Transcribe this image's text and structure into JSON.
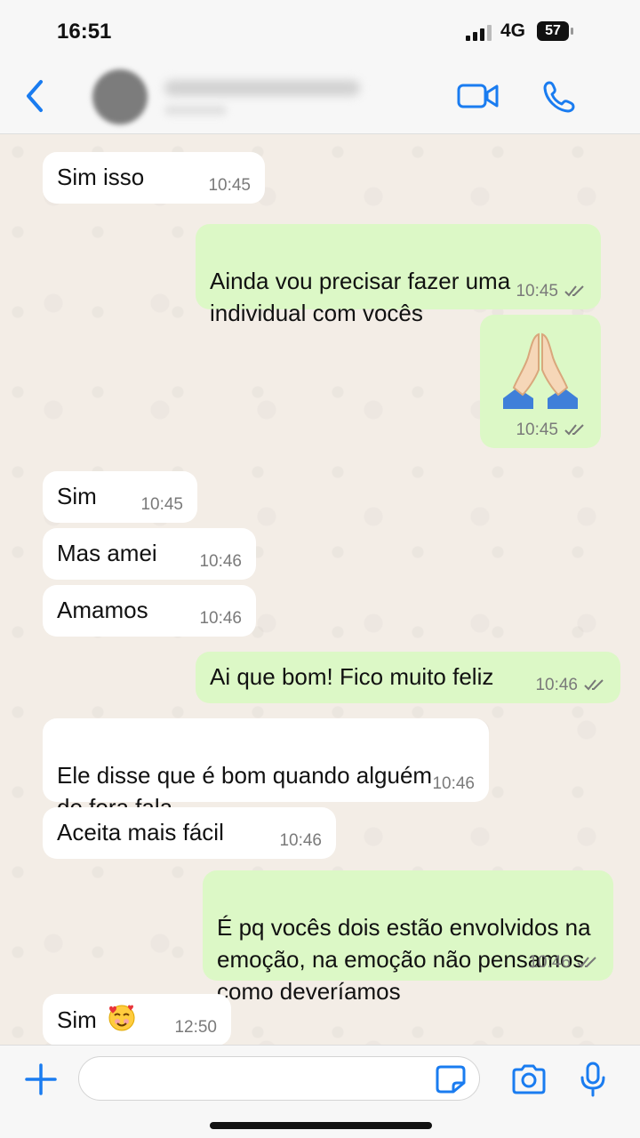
{
  "status_bar": {
    "time": "16:51",
    "network": "4G",
    "battery": "57"
  },
  "header": {
    "icons": [
      "chevron-left-icon",
      "video-call-icon",
      "phone-icon"
    ]
  },
  "messages": [
    {
      "dir": "in",
      "text": "Sim isso",
      "time": "10:45"
    },
    {
      "dir": "out",
      "text": "Ainda vou precisar fazer uma\nindividual com vocês",
      "time": "10:45",
      "read": true
    },
    {
      "dir": "out",
      "emoji": "folded-hands",
      "time": "10:45",
      "read": true
    },
    {
      "dir": "in",
      "text": "Sim",
      "time": "10:45"
    },
    {
      "dir": "in",
      "text": "Mas amei",
      "time": "10:46"
    },
    {
      "dir": "in",
      "text": "Amamos",
      "time": "10:46"
    },
    {
      "dir": "out",
      "text": "Ai que bom! Fico muito feliz",
      "time": "10:46",
      "read": true
    },
    {
      "dir": "in",
      "text": "Ele disse que é bom quando alguém\nde fora fala",
      "time": "10:46"
    },
    {
      "dir": "in",
      "text": "Aceita mais fácil",
      "time": "10:46"
    },
    {
      "dir": "out",
      "text": "É pq vocês dois estão envolvidos na\nemoção,  na emoção não pensamos\ncomo deveríamos",
      "time": "10:46",
      "read": true
    },
    {
      "dir": "in",
      "text": "Sim",
      "emoji": "smiling-face-with-hearts",
      "time": "12:50"
    }
  ],
  "composer": {
    "placeholder": ""
  },
  "colors": {
    "accent": "#1a7cf0",
    "incoming": "#ffffff",
    "outgoing": "#dcf8c6",
    "background": "#f3ede6"
  }
}
